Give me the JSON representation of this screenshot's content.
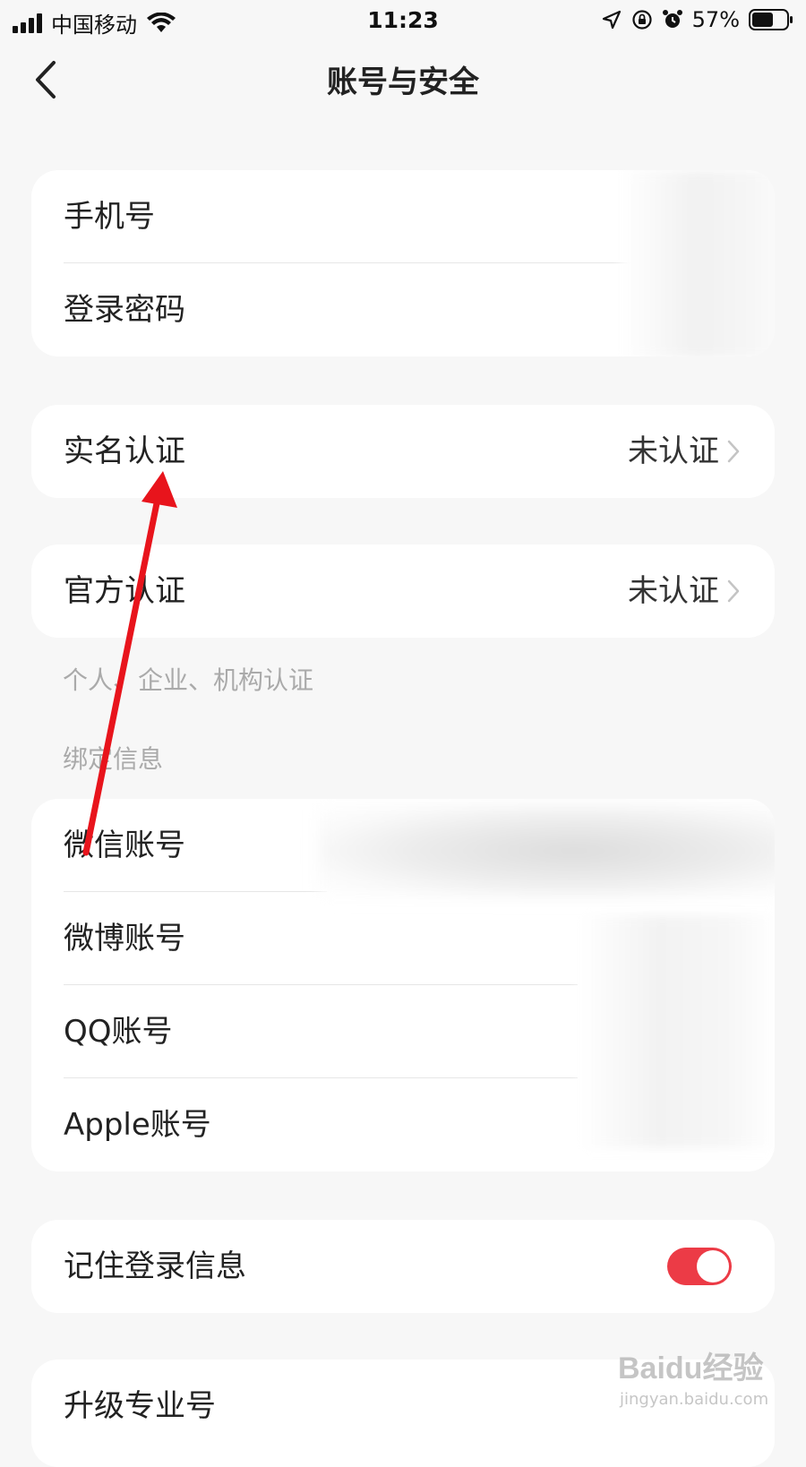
{
  "status_bar": {
    "carrier": "中国移动",
    "time": "11:23",
    "battery_percent": "57%"
  },
  "nav": {
    "title": "账号与安全"
  },
  "group_account": [
    {
      "label": "手机号"
    },
    {
      "label": "登录密码"
    }
  ],
  "real_name": {
    "label": "实名认证",
    "value": "未认证"
  },
  "official": {
    "label": "官方认证",
    "value": "未认证",
    "hint": "个人、企业、机构认证"
  },
  "binding": {
    "section_title": "绑定信息",
    "items": [
      {
        "label": "微信账号"
      },
      {
        "label": "微博账号"
      },
      {
        "label": "QQ账号"
      },
      {
        "label": "Apple账号"
      }
    ]
  },
  "remember_login": {
    "label": "记住登录信息",
    "enabled": true
  },
  "upgrade": {
    "label": "升级专业号"
  },
  "watermark": {
    "brand": "Baidu经验",
    "site": "jingyan.baidu.com"
  },
  "colors": {
    "accent": "#ec3b46",
    "annotation": "#e8141c",
    "background": "#f7f7f7"
  }
}
